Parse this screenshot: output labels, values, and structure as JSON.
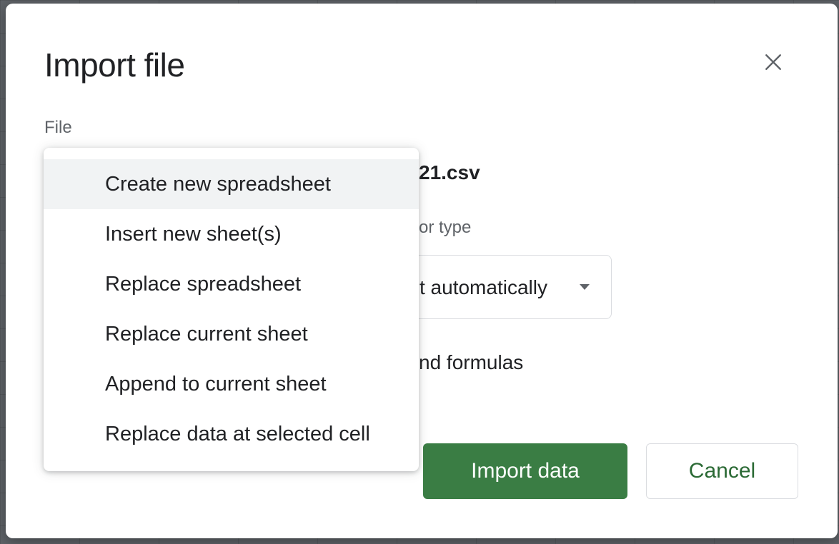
{
  "dialog": {
    "title": "Import file",
    "file_label": "File",
    "file_name_visible": "21.csv",
    "separator_label_visible": "or type",
    "separator_value_visible": "t automatically",
    "convert_label_visible": "nd formulas",
    "import_button": "Import data",
    "cancel_button": "Cancel"
  },
  "location_menu": {
    "items": [
      {
        "label": "Create new spreadsheet",
        "highlighted": true
      },
      {
        "label": "Insert new sheet(s)"
      },
      {
        "label": "Replace spreadsheet"
      },
      {
        "label": "Replace current sheet"
      },
      {
        "label": "Append to current sheet"
      },
      {
        "label": "Replace data at selected cell"
      }
    ]
  },
  "icons": {
    "close": "close-icon",
    "dropdown": "arrow-drop-down-icon"
  },
  "colors": {
    "primary_button": "#3a7d44",
    "cancel_text": "#2b6a35",
    "menu_highlight": "#f1f3f4"
  }
}
